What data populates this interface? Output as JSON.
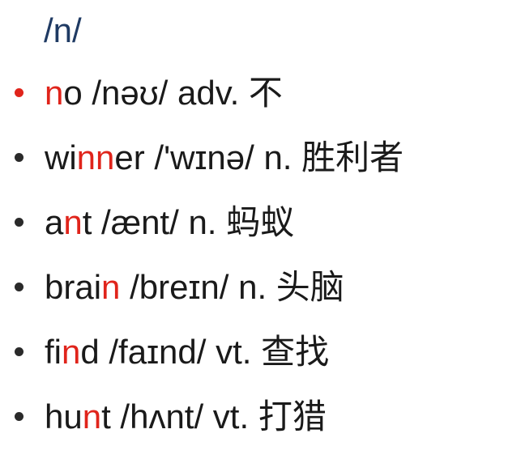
{
  "heading": "/n/",
  "colors": {
    "highlight": "#e0241b",
    "text": "#1a1a1a",
    "heading": "#1f3a63"
  },
  "words": [
    {
      "bullet_color": "red",
      "segments": [
        {
          "text": "n",
          "highlight": true
        },
        {
          "text": "o",
          "highlight": false
        }
      ],
      "rest": " /nəʊ/ adv. 不"
    },
    {
      "bullet_color": "dark",
      "segments": [
        {
          "text": "wi",
          "highlight": false
        },
        {
          "text": "nn",
          "highlight": true
        },
        {
          "text": "er",
          "highlight": false
        }
      ],
      "rest": " /'wɪnə/ n. 胜利者"
    },
    {
      "bullet_color": "dark",
      "segments": [
        {
          "text": "a",
          "highlight": false
        },
        {
          "text": "n",
          "highlight": true
        },
        {
          "text": "t",
          "highlight": false
        }
      ],
      "rest": " /ænt/ n. 蚂蚁"
    },
    {
      "bullet_color": "dark",
      "segments": [
        {
          "text": "brai",
          "highlight": false
        },
        {
          "text": "n",
          "highlight": true
        }
      ],
      "rest": " /breɪn/ n. 头脑"
    },
    {
      "bullet_color": "dark",
      "segments": [
        {
          "text": "fi",
          "highlight": false
        },
        {
          "text": "n",
          "highlight": true
        },
        {
          "text": "d",
          "highlight": false
        }
      ],
      "rest": " /faɪnd/ vt. 查找"
    },
    {
      "bullet_color": "dark",
      "segments": [
        {
          "text": "hu",
          "highlight": false
        },
        {
          "text": "n",
          "highlight": true
        },
        {
          "text": "t",
          "highlight": false
        }
      ],
      "rest": " /hʌnt/ vt. 打猎"
    }
  ]
}
